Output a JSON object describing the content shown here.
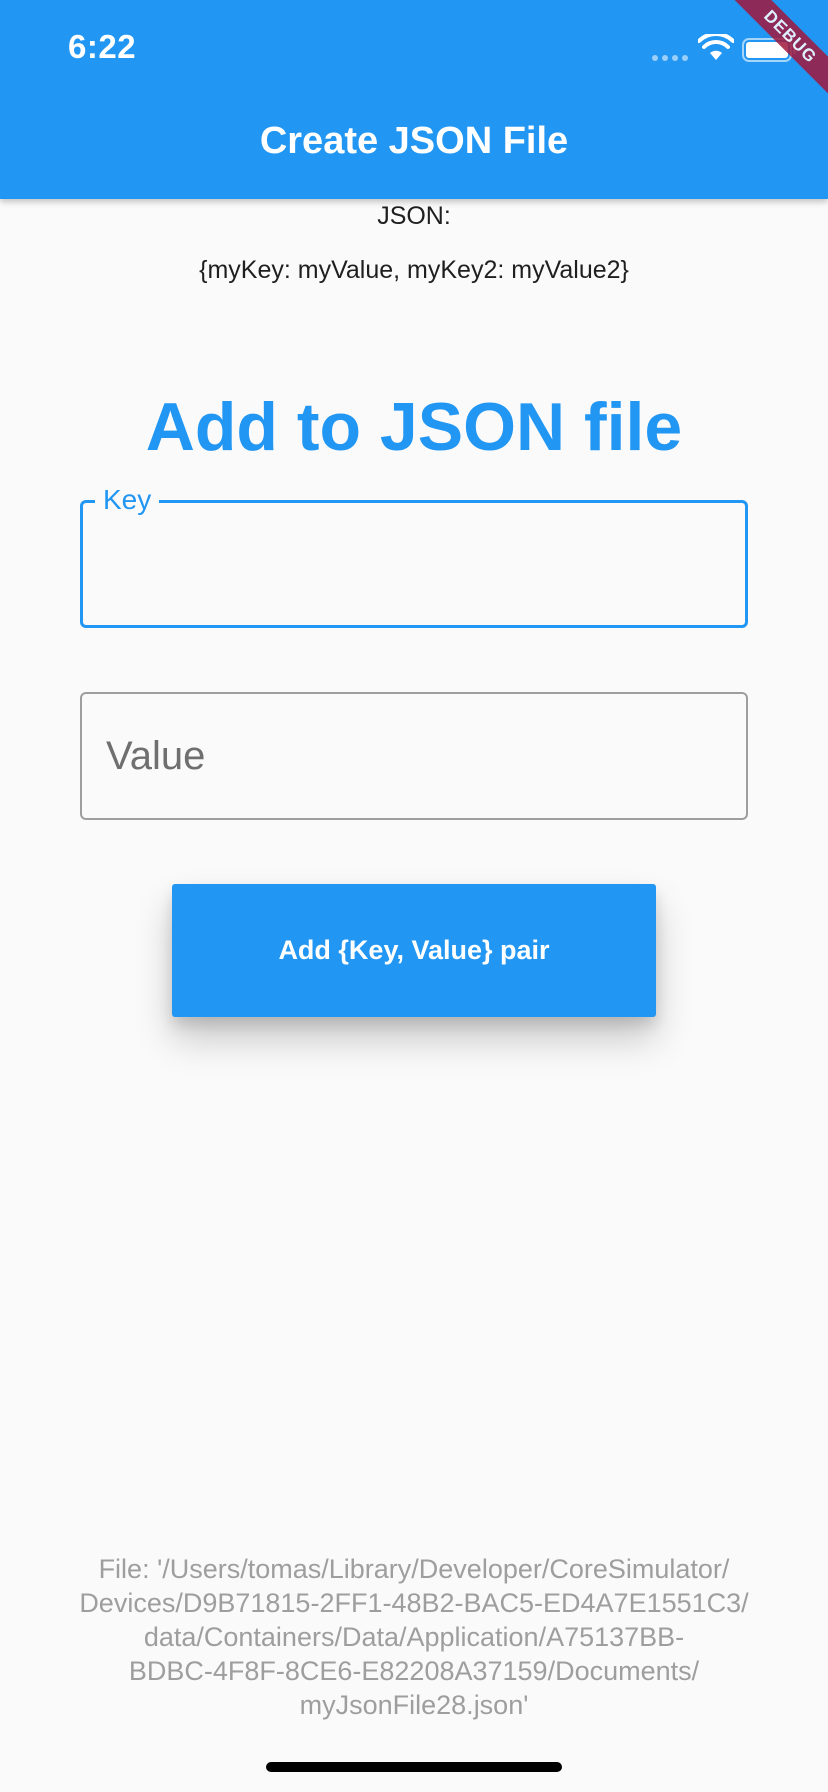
{
  "status_bar": {
    "time": "6:22"
  },
  "app_bar": {
    "title": "Create JSON File",
    "background_color": "#2196f3"
  },
  "debug_banner": {
    "label": "DEBUG",
    "color": "#a0183d"
  },
  "json_display": {
    "label": "JSON:",
    "content": "{myKey: myValue, myKey2: myValue2}"
  },
  "form": {
    "heading": "Add to JSON file",
    "key_field": {
      "label": "Key",
      "value": ""
    },
    "value_field": {
      "placeholder": "Value",
      "value": ""
    },
    "submit_label": "Add {Key, Value} pair"
  },
  "file_info": {
    "path_text": "File: '/Users/tomas/Library/Developer/CoreSimulator/\nDevices/D9B71815-2FF1-48B2-BAC5-ED4A7E1551C3/\ndata/Containers/Data/Application/A75137BB-\nBDBC-4F8F-8CE6-E82208A37159/Documents/\nmyJsonFile28.json'"
  },
  "colors": {
    "primary": "#2196f3",
    "background": "#fafafa",
    "muted_text": "#9e9e9e"
  }
}
